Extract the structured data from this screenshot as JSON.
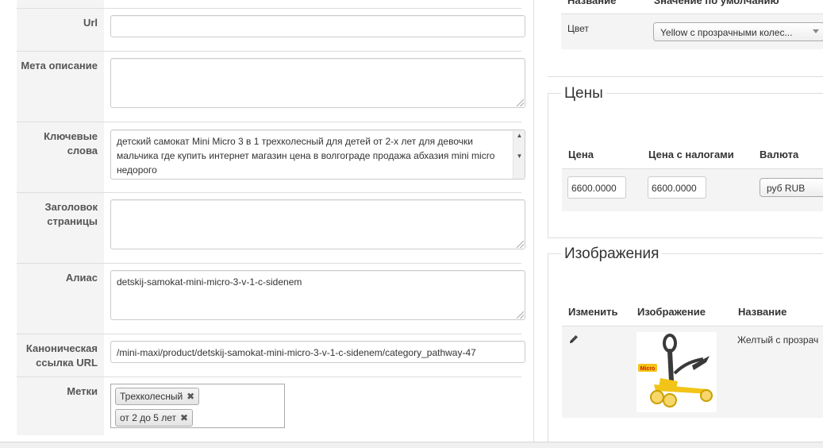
{
  "form": {
    "url_label": "Url",
    "url_value": "",
    "meta_label": "Мета описание",
    "meta_value": "",
    "keywords_label": "Ключевые слова",
    "keywords_value": "детский самокат Mini Micro 3 в 1 трехколесный для детей от 2-х лет для девочки мальчика где купить интернет магазин цена в волгограде продажа абхазия mini micro недорого",
    "page_title_label": "Заголовок страницы",
    "page_title_value": "",
    "alias_label": "Алиас",
    "alias_value": "detskij-samokat-mini-micro-3-v-1-c-sidenem",
    "canonical_label": "Каноническая ссылка URL",
    "canonical_value": "/mini-maxi/product/detskij-samokat-mini-micro-3-v-1-c-sidenem/category_pathway-47",
    "tags_label": "Метки",
    "tags": [
      "Трехколесный",
      "от 2 до 5 лет"
    ]
  },
  "attributes": {
    "col_name": "Название",
    "col_default": "Значение по умолчанию",
    "row_name": "Цвет",
    "row_value": "Yellow с прозрачными колес..."
  },
  "prices": {
    "legend": "Цены",
    "col_price": "Цена",
    "col_price_tax": "Цена с налогами",
    "col_currency": "Валюта",
    "price": "6600.0000",
    "price_tax": "6600.0000",
    "currency": "руб RUB"
  },
  "images": {
    "legend": "Изображения",
    "col_edit": "Изменить",
    "col_image": "Изображение",
    "col_name": "Название",
    "row_name": "Желтый с прозрач",
    "thumb_brand": "Micro"
  },
  "colors": {
    "scooter_yellow": "#f2c417",
    "scooter_dark": "#3a3a3a",
    "border": "#dddddd",
    "label_bg": "#f4f4f4"
  }
}
